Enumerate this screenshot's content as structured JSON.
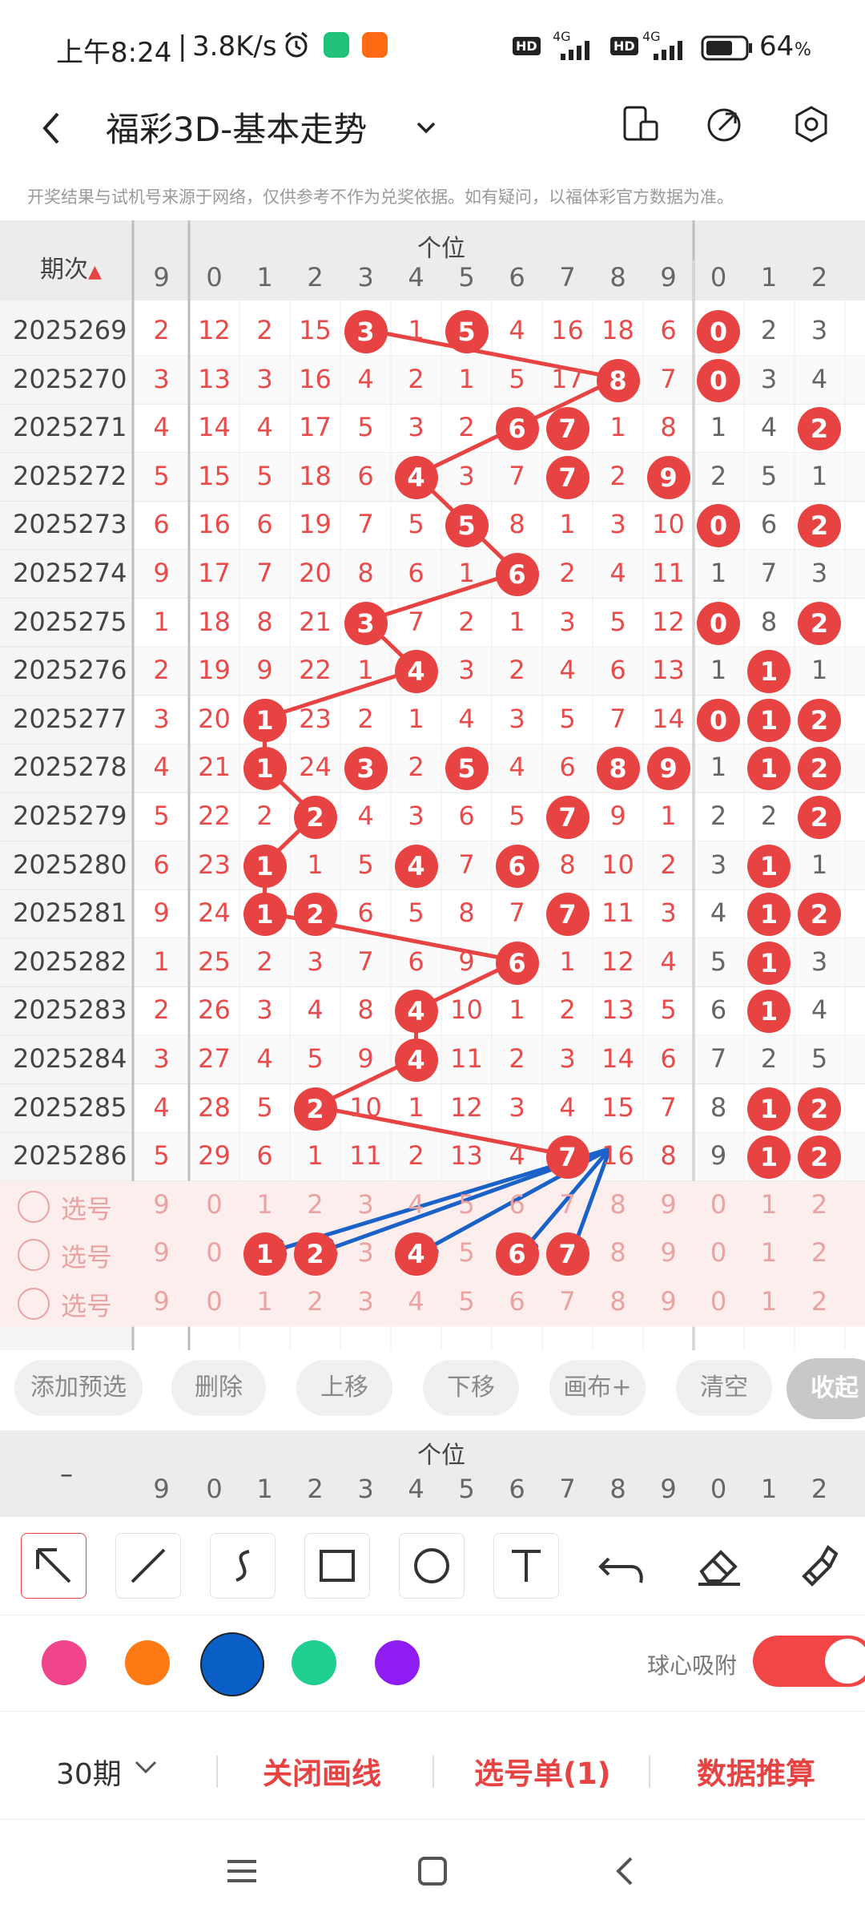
{
  "status": {
    "time": "上午8:24",
    "speed": "3.8K/s",
    "hd1": "HD",
    "net1": "4G",
    "hd2": "HD",
    "net2": "4G",
    "battery": "64"
  },
  "appbar": {
    "title": "福彩3D-基本走势",
    "notice": "开奖结果与试机号来源于网络，仅供参考不作为兑奖依据。如有疑问，以福体彩官方数据为准。"
  },
  "header": {
    "issue_label": "期次",
    "group_label": "个位",
    "left_col": "9",
    "digits": [
      "0",
      "1",
      "2",
      "3",
      "4",
      "5",
      "6",
      "7",
      "8",
      "9"
    ],
    "extra": [
      "0",
      "1",
      "2"
    ]
  },
  "rows": [
    {
      "issue": "2025269",
      "first": "2",
      "cells": [
        "12",
        "2",
        "15",
        "3",
        "1",
        "5",
        "4",
        "16",
        "18",
        "6"
      ],
      "extra": [
        "0",
        "2",
        "3"
      ]
    },
    {
      "issue": "2025270",
      "first": "3",
      "cells": [
        "13",
        "3",
        "16",
        "4",
        "2",
        "1",
        "5",
        "17",
        "8",
        "7"
      ],
      "extra": [
        "0",
        "3",
        "4"
      ]
    },
    {
      "issue": "2025271",
      "first": "4",
      "cells": [
        "14",
        "4",
        "17",
        "5",
        "3",
        "2",
        "6",
        "7",
        "1",
        "8"
      ],
      "extra": [
        "1",
        "4",
        "2"
      ]
    },
    {
      "issue": "2025272",
      "first": "5",
      "cells": [
        "15",
        "5",
        "18",
        "6",
        "4",
        "3",
        "7",
        "7",
        "2",
        "9"
      ],
      "extra": [
        "2",
        "5",
        "1"
      ]
    },
    {
      "issue": "2025273",
      "first": "6",
      "cells": [
        "16",
        "6",
        "19",
        "7",
        "5",
        "5",
        "8",
        "1",
        "3",
        "10"
      ],
      "extra": [
        "0",
        "6",
        "2"
      ]
    },
    {
      "issue": "2025274",
      "first": "9",
      "cells": [
        "17",
        "7",
        "20",
        "8",
        "6",
        "1",
        "6",
        "2",
        "4",
        "11"
      ],
      "extra": [
        "1",
        "7",
        "3"
      ]
    },
    {
      "issue": "2025275",
      "first": "1",
      "cells": [
        "18",
        "8",
        "21",
        "3",
        "7",
        "2",
        "1",
        "3",
        "5",
        "12"
      ],
      "extra": [
        "0",
        "8",
        "2"
      ]
    },
    {
      "issue": "2025276",
      "first": "2",
      "cells": [
        "19",
        "9",
        "22",
        "1",
        "4",
        "3",
        "2",
        "4",
        "6",
        "13"
      ],
      "extra": [
        "1",
        "1",
        "1"
      ]
    },
    {
      "issue": "2025277",
      "first": "3",
      "cells": [
        "20",
        "1",
        "23",
        "2",
        "1",
        "4",
        "3",
        "5",
        "7",
        "14"
      ],
      "extra": [
        "0",
        "1",
        "2"
      ]
    },
    {
      "issue": "2025278",
      "first": "4",
      "cells": [
        "21",
        "1",
        "24",
        "3",
        "2",
        "5",
        "4",
        "6",
        "8",
        "9"
      ],
      "extra": [
        "1",
        "1",
        "2"
      ]
    },
    {
      "issue": "2025279",
      "first": "5",
      "cells": [
        "22",
        "2",
        "2",
        "4",
        "3",
        "6",
        "5",
        "7",
        "9",
        "1"
      ],
      "extra": [
        "2",
        "2",
        "2"
      ]
    },
    {
      "issue": "2025280",
      "first": "6",
      "cells": [
        "23",
        "1",
        "1",
        "5",
        "4",
        "7",
        "6",
        "8",
        "10",
        "2"
      ],
      "extra": [
        "3",
        "1",
        "1"
      ]
    },
    {
      "issue": "2025281",
      "first": "9",
      "cells": [
        "24",
        "1",
        "2",
        "6",
        "5",
        "8",
        "7",
        "7",
        "11",
        "3"
      ],
      "extra": [
        "4",
        "1",
        "2"
      ]
    },
    {
      "issue": "2025282",
      "first": "1",
      "cells": [
        "25",
        "2",
        "3",
        "7",
        "6",
        "9",
        "6",
        "1",
        "12",
        "4"
      ],
      "extra": [
        "5",
        "1",
        "3"
      ]
    },
    {
      "issue": "2025283",
      "first": "2",
      "cells": [
        "26",
        "3",
        "4",
        "8",
        "4",
        "10",
        "1",
        "2",
        "13",
        "5"
      ],
      "extra": [
        "6",
        "1",
        "4"
      ]
    },
    {
      "issue": "2025284",
      "first": "3",
      "cells": [
        "27",
        "4",
        "5",
        "9",
        "4",
        "11",
        "2",
        "3",
        "14",
        "6"
      ],
      "extra": [
        "7",
        "2",
        "5"
      ]
    },
    {
      "issue": "2025285",
      "first": "4",
      "cells": [
        "28",
        "5",
        "2",
        "10",
        "1",
        "12",
        "3",
        "4",
        "15",
        "7"
      ],
      "extra": [
        "8",
        "1",
        "2"
      ]
    },
    {
      "issue": "2025286",
      "first": "5",
      "cells": [
        "29",
        "6",
        "1",
        "11",
        "2",
        "13",
        "4",
        "7",
        "16",
        "8"
      ],
      "extra": [
        "9",
        "1",
        "2"
      ]
    }
  ],
  "select_rows": {
    "label": "选号",
    "first": "9",
    "digits": [
      "0",
      "1",
      "2",
      "3",
      "4",
      "5",
      "6",
      "7",
      "8",
      "9"
    ],
    "extra": [
      "0",
      "1",
      "2"
    ]
  },
  "actions": [
    "添加预选",
    "删除",
    "上移",
    "下移",
    "画布+",
    "清空",
    "收起"
  ],
  "bottom_header": {
    "dash": "–",
    "group_label": "个位",
    "left_col": "9",
    "digits": [
      "0",
      "1",
      "2",
      "3",
      "4",
      "5",
      "6",
      "7",
      "8",
      "9"
    ],
    "extra": [
      "0",
      "1",
      "2"
    ]
  },
  "tools": [
    "pointer-tool",
    "line-tool",
    "curve-tool",
    "rect-tool",
    "circle-tool",
    "text-tool",
    "undo-tool",
    "eraser-tool",
    "clear-tool"
  ],
  "colors": [
    "#f0458c",
    "#ff7a14",
    "#0a5fc7",
    "#1fcf8f",
    "#8f1cf0"
  ],
  "snap_label": "球心吸附",
  "snap_on": true,
  "footer": {
    "period": "30期",
    "close_lines": "关闭画线",
    "selection": "选号单(1)",
    "calc": "数据推算"
  }
}
